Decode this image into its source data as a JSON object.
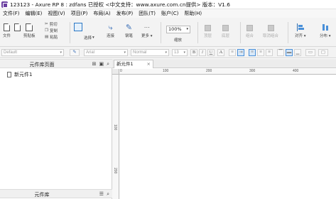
{
  "window": {
    "title": "123123 - Axure RP 8 : zdfans 已授权      <中文支持：www.axure.com.cn提供> 版本：V1.6"
  },
  "menu": [
    "文件(F)",
    "编辑(E)",
    "视图(V)",
    "项目(P)",
    "布局(A)",
    "发布(P)",
    "团队(T)",
    "账户(C)",
    "帮助(H)"
  ],
  "toolbar": {
    "file_label": "文件",
    "clipboard_label": "剪贴板",
    "cut_label": "剪切",
    "copy_label": "复制",
    "paste_label": "粘贴",
    "select_label": "选择",
    "connect_label": "连接",
    "pen_label": "钢笔",
    "more_label": "更多",
    "zoom_value": "100%",
    "zoom_label": "缩放",
    "top_label": "顶层",
    "bottom_label": "底层",
    "group_label": "组合",
    "ungroup_label": "取消组合",
    "align_label": "对齐",
    "distribute_label": "分布"
  },
  "formatbar": {
    "style_value": "Default",
    "font_value": "Arial",
    "weight_value": "Normal",
    "size_value": "13"
  },
  "pages_panel": {
    "title": "元件库页面",
    "pages": [
      "新元件1"
    ]
  },
  "library_panel": {
    "title": "元件库"
  },
  "canvas": {
    "tab_label": "新元件1",
    "ruler_h": [
      "0",
      "100",
      "200",
      "300",
      "400"
    ],
    "ruler_v": [
      "100",
      "200"
    ]
  }
}
